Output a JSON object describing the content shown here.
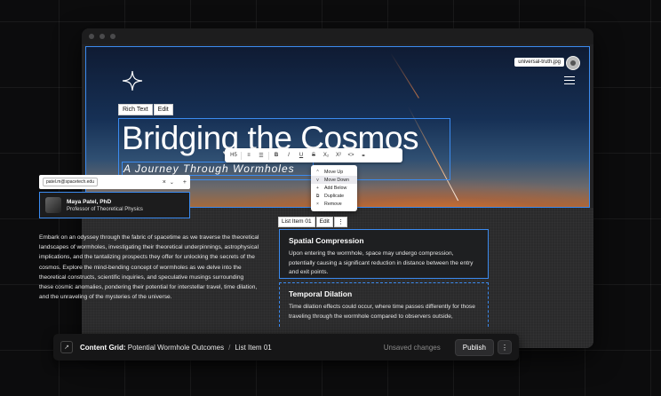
{
  "hero": {
    "file_name": "universal-truth.jpg",
    "title": "Bridging the Cosmos",
    "subtitle": "A Journey Through Wormholes",
    "rich_text_tag": "Rich Text",
    "edit_tag": "Edit"
  },
  "format_toolbar": {
    "heading": "H5",
    "bold": "B",
    "italic": "I",
    "underline": "U",
    "strike": "S",
    "subscript": "X₂",
    "superscript": "X²",
    "code": "<>"
  },
  "author_select": {
    "email_chip": "patel.m@spacetech.edu",
    "clear": "×",
    "chevron": "⌄",
    "add": "+"
  },
  "author": {
    "name": "Maya Patel, PhD",
    "role": "Professor of Theoretical Physics"
  },
  "body_text": "Embark on an odyssey through the fabric of spacetime as we traverse the theoretical landscapes of wormholes, investigating their theoretical underpinnings, astrophysical implications, and the tantalizing prospects they offer for unlocking the secrets of the cosmos. Explore the mind-bending concept of wormholes as we delve into the theoretical constructs, scientific inquiries, and speculative musings surrounding these cosmic anomalies, pondering their potential for interstellar travel, time dilation, and the unraveling of the mysteries of the universe.",
  "context_menu": {
    "items": [
      {
        "icon": "^",
        "label": "Move Up"
      },
      {
        "icon": "v",
        "label": "Move Down"
      },
      {
        "icon": "+",
        "label": "Add Below"
      },
      {
        "icon": "⧉",
        "label": "Duplicate"
      },
      {
        "icon": "×",
        "label": "Remove"
      }
    ]
  },
  "list_item": {
    "tag": "List Item 01",
    "edit": "Edit",
    "more": "⋮"
  },
  "cards": [
    {
      "title": "Spatial Compression",
      "text": "Upon entering the wormhole, space may undergo compression, potentially causing a significant reduction in distance between the entry and exit points."
    },
    {
      "title": "Temporal Dilation",
      "text": "Time dilation effects could occur, where time passes differently for those traveling through the wormhole compared to observers outside,"
    }
  ],
  "status_bar": {
    "section_label": "Content Grid:",
    "section_value": "Potential Wormhole Outcomes",
    "separator": "/",
    "current": "List Item 01",
    "unsaved": "Unsaved changes",
    "publish": "Publish",
    "more": "⋮"
  },
  "colors": {
    "selection": "#3b8bf0",
    "background": "#0c0c0d"
  }
}
